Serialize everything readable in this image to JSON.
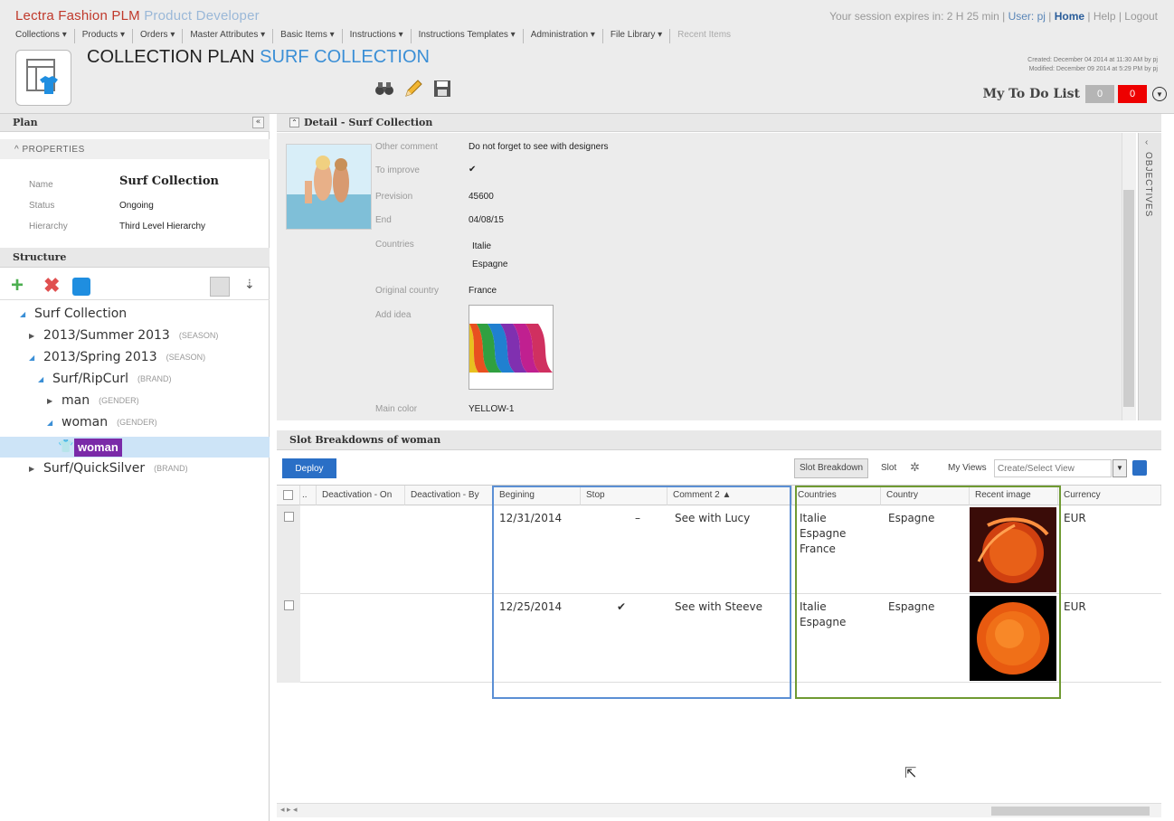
{
  "app": {
    "name_part1": "Lectra Fashion ",
    "name_part2": "PLM ",
    "name_part3": "Product Developer"
  },
  "session": {
    "prefix": "Your session expires in: 2 H 25 min | ",
    "user": "User: pj",
    "sep1": " | ",
    "home": "Home",
    "rest": " | Help | Logout"
  },
  "menu": [
    "Collections ▾",
    "Products ▾",
    "Orders ▾",
    "Master Attributes ▾",
    "Basic Items ▾",
    "Instructions ▾",
    "Instructions Templates ▾",
    "Administration ▾",
    "File Library ▾",
    "Recent Items"
  ],
  "page": {
    "title_prefix": "COLLECTION PLAN ",
    "title_accent": "SURF COLLECTION",
    "created": "Created: December 04 2014 at 11:30 AM by pj",
    "modified": "Modified: December 09 2014 at 5:29 PM by pj"
  },
  "todo": {
    "label": "My To Do List",
    "count_grey": "0",
    "count_red": "0"
  },
  "left": {
    "plan": "Plan",
    "collapse": "«",
    "properties": "^ PROPERTIES",
    "props": [
      {
        "k": "Name",
        "v": "Surf Collection"
      },
      {
        "k": "Status",
        "v": "Ongoing"
      },
      {
        "k": "Hierarchy",
        "v": "Third Level Hierarchy"
      }
    ],
    "structure": "Structure"
  },
  "tree": [
    {
      "label": "Surf Collection",
      "tag": ""
    },
    {
      "label": "2013/Summer 2013",
      "tag": "(SEASON)"
    },
    {
      "label": "2013/Spring 2013",
      "tag": "(SEASON)"
    },
    {
      "label": "Surf/RipCurl",
      "tag": "(BRAND)"
    },
    {
      "label": "man",
      "tag": "(GENDER)"
    },
    {
      "label": "woman",
      "tag": "(GENDER)"
    },
    {
      "label": "woman",
      "tag": ""
    },
    {
      "label": "Surf/QuickSilver",
      "tag": "(BRAND)"
    }
  ],
  "detail": {
    "header": "Detail - Surf Collection",
    "fields": [
      {
        "k": "Other comment",
        "v": "Do not forget to see with designers"
      },
      {
        "k": "To improve",
        "v": "✔"
      },
      {
        "k": "Prevision",
        "v": "45600"
      },
      {
        "k": "End",
        "v": "04/08/15"
      },
      {
        "k": "Countries",
        "v": "Italie"
      },
      {
        "k": "",
        "v": "Espagne"
      },
      {
        "k": "Original country",
        "v": "France"
      },
      {
        "k": "Add idea",
        "v": ""
      },
      {
        "k": "Main color",
        "v": "YELLOW-1"
      }
    ],
    "objectives": "OBJECTIVES"
  },
  "slot": {
    "header": "Slot Breakdowns of woman",
    "deploy": "Deploy",
    "tab": "Slot Breakdown",
    "slot": "Slot",
    "myviews": "My Views",
    "view_placeholder": "Create/Select View",
    "columns": [
      "..",
      "Deactivation - On",
      "Deactivation - By",
      "Begining",
      "Stop",
      "Comment 2 ▲",
      "Countries",
      "Country",
      "Recent image",
      "Currency"
    ],
    "rows": [
      {
        "begin": "12/31/2014",
        "stop": "–",
        "comment": "See with Lucy",
        "countries": [
          "Italie",
          "Espagne",
          "France"
        ],
        "country": "Espagne",
        "currency": "EUR"
      },
      {
        "begin": "12/25/2014",
        "stop": "✔",
        "comment": "See with Steeve",
        "countries": [
          "Italie",
          "Espagne"
        ],
        "country": "Espagne",
        "currency": "EUR"
      }
    ]
  },
  "colors": {
    "accent": "#3b8fd6",
    "brand_red": "#c0392b",
    "selected": "#7a2aa8",
    "highlight_blue": "#5b8fd4",
    "highlight_green": "#6f9a32"
  }
}
